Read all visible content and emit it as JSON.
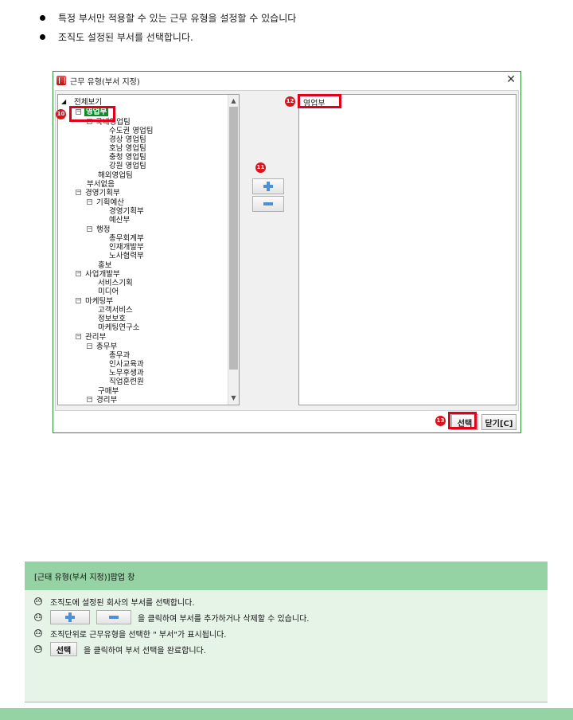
{
  "bullets": [
    "특정 부서만 적용할 수 있는 근무 유형을 설정할 수 있습니다",
    "조직도 설정된 부서를 선택합니다."
  ],
  "dialog": {
    "title": "근무 유형(부서 지정)",
    "close_glyph": "✕",
    "tree": [
      {
        "label": "전체보기"
      },
      {
        "label": "영업부"
      },
      {
        "label": "국내영업팀"
      },
      {
        "label": "수도권 영업팀"
      },
      {
        "label": "경상 영업팀"
      },
      {
        "label": "호남 영업팀"
      },
      {
        "label": "충청 영업팀"
      },
      {
        "label": "강원 영업팀"
      },
      {
        "label": "해외영업팀"
      },
      {
        "label": "부서없음"
      },
      {
        "label": "경영기획부"
      },
      {
        "label": "기획예산"
      },
      {
        "label": "경영기획부"
      },
      {
        "label": "예산부"
      },
      {
        "label": "행정"
      },
      {
        "label": "총무회계부"
      },
      {
        "label": "인재개발부"
      },
      {
        "label": "노사협력부"
      },
      {
        "label": "홍보"
      },
      {
        "label": "사업개발부"
      },
      {
        "label": "서비스기획"
      },
      {
        "label": "미디어"
      },
      {
        "label": "마케팅부"
      },
      {
        "label": "고객서비스"
      },
      {
        "label": "정보보호"
      },
      {
        "label": "마케팅연구소"
      },
      {
        "label": "관리부"
      },
      {
        "label": "총무부"
      },
      {
        "label": "총무과"
      },
      {
        "label": "인사교육과"
      },
      {
        "label": "노무후생과"
      },
      {
        "label": "직업훈련원"
      },
      {
        "label": "구매부"
      },
      {
        "label": "경리부"
      }
    ],
    "selected_department": "영업부",
    "select_button": "선택",
    "close_button": "닫기[C]",
    "markers": {
      "tree": "10",
      "buttons": "11",
      "selected": "12",
      "select": "13"
    }
  },
  "info": {
    "header": "[근태 유형(부서 지정)]팝업 창",
    "rows": [
      {
        "num": "10",
        "text": "조직도에 설정된 회사의  부서를 선택합니다."
      },
      {
        "num": "11",
        "text": "을 클릭하여 부서를 추가하거나 삭제할 수 있습니다."
      },
      {
        "num": "12",
        "text": "조직단위로 근무유형을 선택한 \" 부서\"가 표시됩니다."
      },
      {
        "num": "13",
        "text": "을 클릭하여 부서 선택을 완료합니다."
      }
    ],
    "select_button": "선택"
  }
}
